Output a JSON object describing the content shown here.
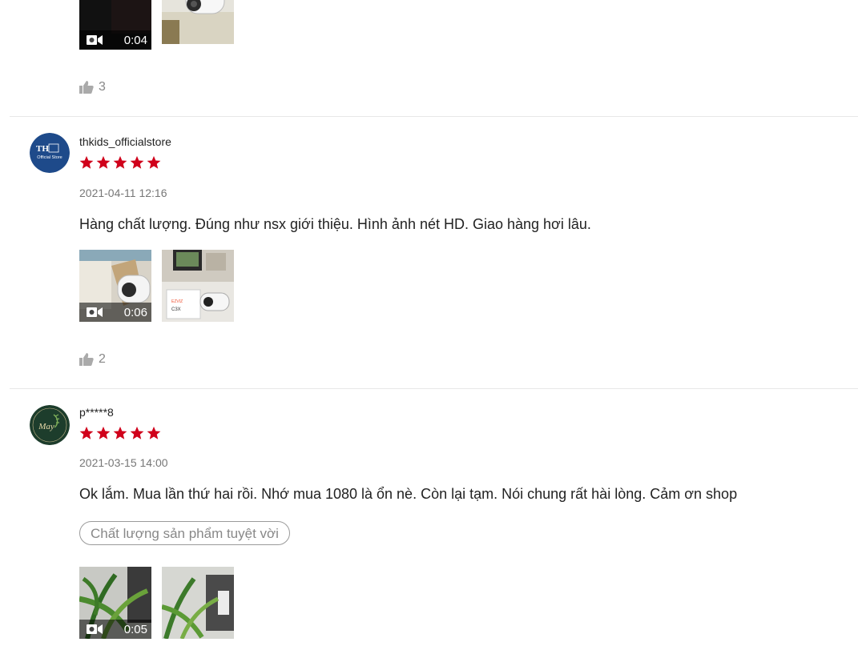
{
  "reviews": [
    {
      "likes": "3",
      "media": [
        {
          "type": "video",
          "duration": "0:04"
        },
        {
          "type": "image"
        }
      ]
    },
    {
      "username": "thkids_officialstore",
      "avatar": {
        "line1": "TH",
        "line2": "Official Store",
        "bg": "#1e4a8a"
      },
      "rating": 5,
      "date": "2021-04-11 12:16",
      "comment": "Hàng chất lượng. Đúng như nsx giới thiệu. Hình ảnh nét HD. Giao hàng hơi lâu.",
      "likes": "2",
      "media": [
        {
          "type": "video",
          "duration": "0:06"
        },
        {
          "type": "image",
          "text": "C3X"
        }
      ]
    },
    {
      "username": "p*****8",
      "avatar": {
        "line1": "May",
        "bg": "#1d3d2c"
      },
      "rating": 5,
      "date": "2021-03-15 14:00",
      "comment": "Ok lắm. Mua lần thứ hai rồi. Nhớ mua 1080 là ổn nè. Còn lại tạm. Nói chung rất hài lòng. Cảm ơn shop",
      "tag": "Chất lượng sản phẩm tuyệt vời",
      "media": [
        {
          "type": "video",
          "duration": "0:05"
        },
        {
          "type": "image"
        }
      ]
    }
  ],
  "colors": {
    "star": "#d0011b",
    "accent": "#ee4d2d"
  }
}
